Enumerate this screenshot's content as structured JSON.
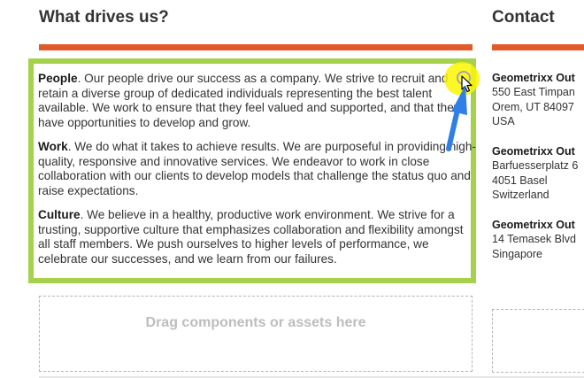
{
  "sections": {
    "drives": {
      "heading": "What drives us?",
      "paragraphs": [
        {
          "title": "People",
          "body": ". Our people drive our success as a company. We strive to recruit and retain a diverse group of dedicated individuals representing the best talent available. We work to ensure that they feel valued and supported, and that they have opportunities to develop and grow."
        },
        {
          "title": "Work",
          "body": ". We do what it takes to achieve results. We are purposeful in providing high-quality, responsive and innovative services. We endeavor to work in close collaboration with our clients to develop models that challenge the status quo and raise expectations."
        },
        {
          "title": "Culture",
          "body": ". We believe in a healthy, productive work environment. We strive for a trusting, supportive culture that emphasizes collaboration and flexibility amongst all staff members. We push ourselves to higher levels of performance, we celebrate our successes, and we learn from our failures."
        }
      ]
    },
    "contact": {
      "heading": "Contact",
      "offices": [
        {
          "name": "Geometrixx Out",
          "lines": [
            "550 East Timpan",
            "Orem, UT 84097",
            "USA"
          ]
        },
        {
          "name": "Geometrixx Out",
          "lines": [
            "Barfuesserplatz 6",
            "4051 Basel",
            "Switzerland"
          ]
        },
        {
          "name": "Geometrixx Out",
          "lines": [
            "14 Temasek Blvd",
            "Singapore"
          ]
        }
      ]
    }
  },
  "dropzone": {
    "label": "Drag components or assets here"
  },
  "colors": {
    "accent_rule": "#e35a2a",
    "editor_border": "#a6d24b",
    "cursor_highlight": "#fcf600",
    "annotation_arrow": "#2f7fe6"
  },
  "icons": {
    "mouse_pointer": "mouse-pointer-icon",
    "annotation_arrow": "arrow-up-right-icon"
  }
}
